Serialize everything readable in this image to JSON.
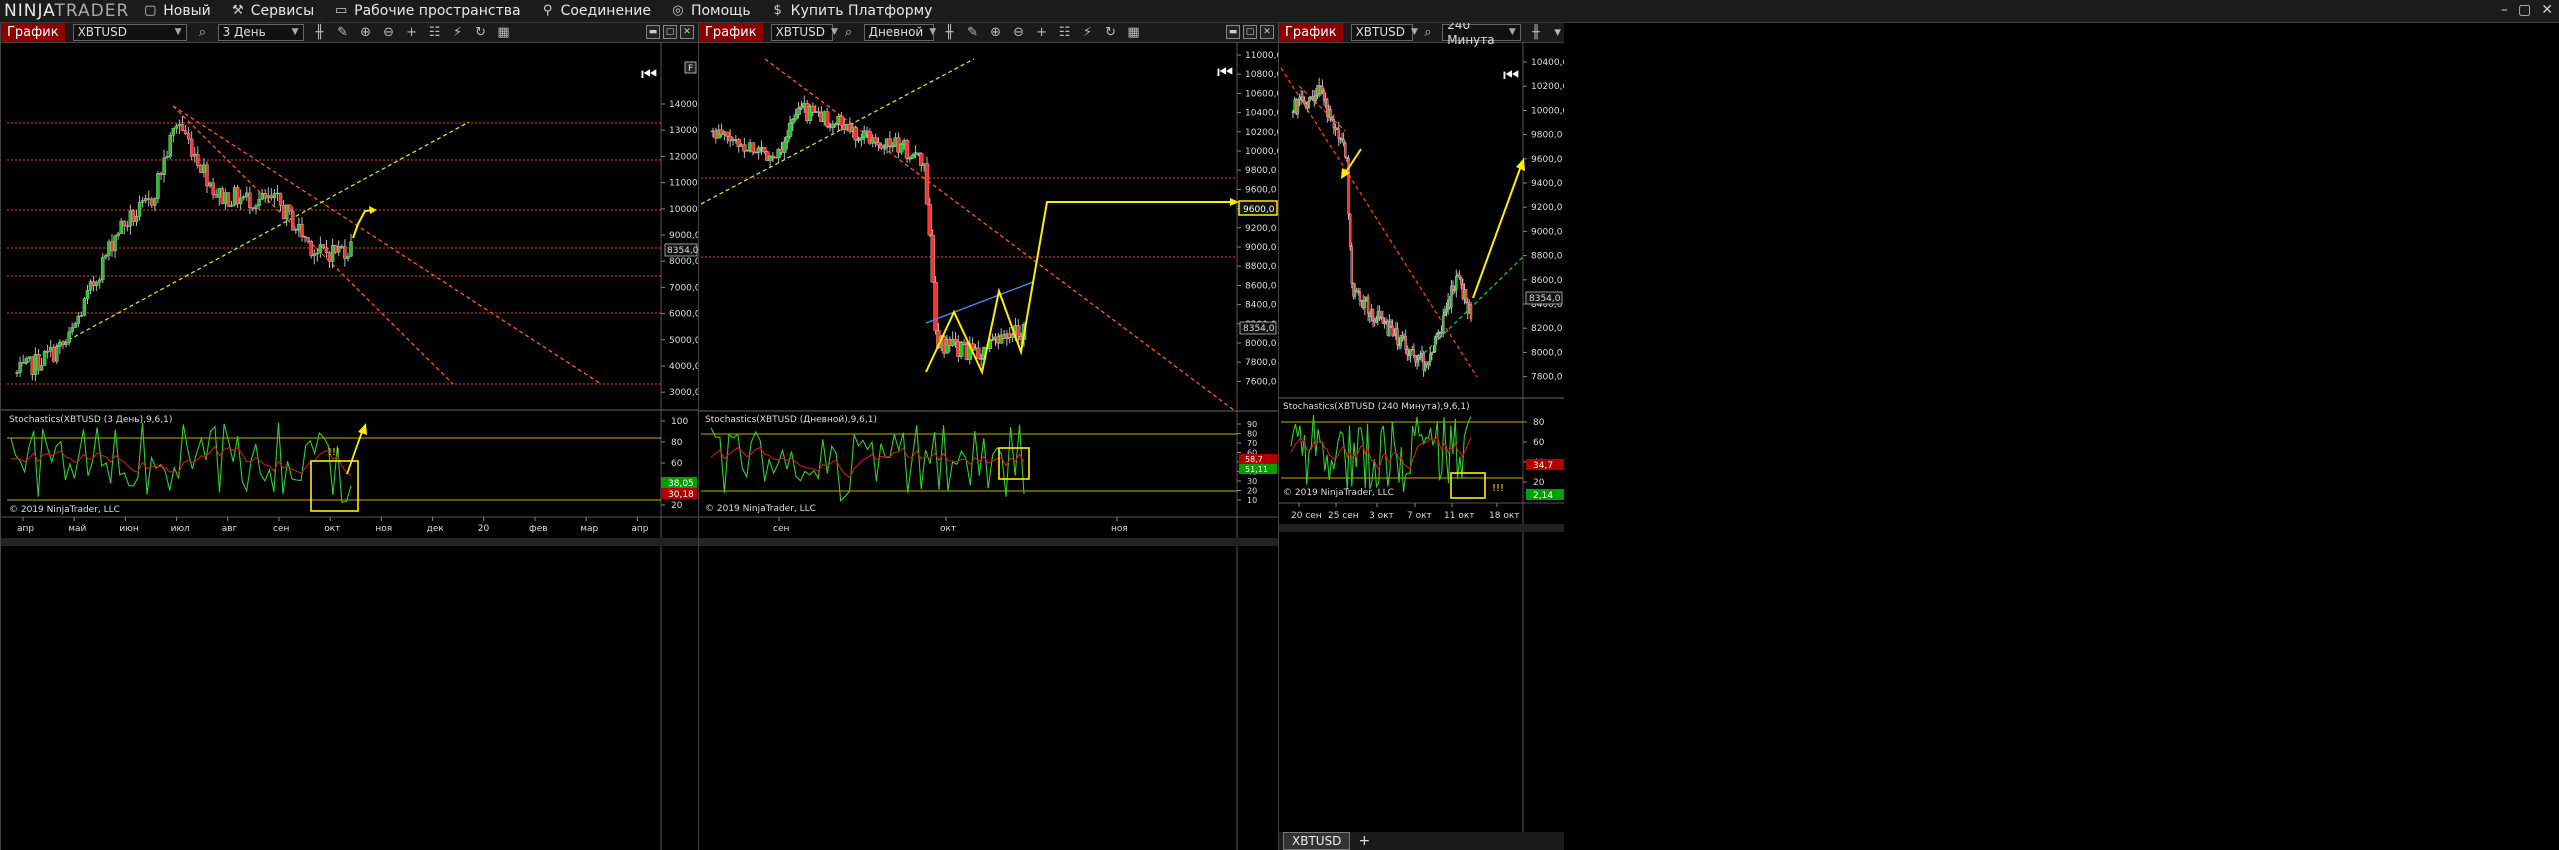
{
  "app": {
    "logo_left": "NINJA",
    "logo_right": "TRADER"
  },
  "menu": [
    {
      "label": "Новый",
      "icon": "document-icon"
    },
    {
      "label": "Сервисы",
      "icon": "tools-icon"
    },
    {
      "label": "Рабочие пространства",
      "icon": "workspace-icon"
    },
    {
      "label": "Соединение",
      "icon": "plug-icon"
    },
    {
      "label": "Помощь",
      "icon": "lifebuoy-icon"
    },
    {
      "label": "Купить Платформу",
      "icon": "dollar-icon"
    }
  ],
  "panels": [
    {
      "title": "График",
      "instrument": "XBTUSD",
      "period": "3 День",
      "price_labels": [
        "14000,0",
        "13000,0",
        "12000,0",
        "11000,0",
        "10000,0",
        "9000,0",
        "8000,0",
        "7000,0",
        "6000,0",
        "5000,0",
        "4000,0",
        "3000,0"
      ],
      "last_price": "8354,0",
      "x_labels": [
        "апр",
        "май",
        "июн",
        "июл",
        "авг",
        "сен",
        "окт",
        "ноя",
        "дек",
        "20",
        "фев",
        "мар",
        "апр"
      ],
      "stoch_title": "Stochastics(XBTUSD (3 День),9,6,1)",
      "stoch_labels": [
        "100",
        "80",
        "60",
        "40",
        "20"
      ],
      "stoch_k": "38,05",
      "stoch_d": "30,18",
      "annotation": "!!!",
      "copyright": "© 2019 NinjaTrader, LLC",
      "f_button": "F"
    },
    {
      "title": "График",
      "instrument": "XBTUSD",
      "period": "Дневной",
      "price_labels": [
        "11000,0",
        "10800,0",
        "10600,0",
        "10400,0",
        "10200,0",
        "10000,0",
        "9800,0",
        "9600,0",
        "9400,0",
        "9200,0",
        "9000,0",
        "8800,0",
        "8600,0",
        "8400,0",
        "8200,0",
        "8000,0",
        "7800,0",
        "7600,0"
      ],
      "last_price": "8354,0",
      "target_price": "9600,0",
      "x_labels": [
        "сен",
        "окт",
        "ноя"
      ],
      "stoch_title": "Stochastics(XBTUSD (Дневной),9,6,1)",
      "stoch_labels": [
        "90",
        "80",
        "70",
        "60",
        "50",
        "40",
        "30",
        "20",
        "10"
      ],
      "stoch_k": "58,7",
      "stoch_d": "51,11",
      "copyright": "© 2019 NinjaTrader, LLC"
    },
    {
      "title": "График",
      "instrument": "XBTUSD",
      "period": "240 Минута",
      "price_labels": [
        "10400,0",
        "10200,0",
        "10000,0",
        "9800,0",
        "9600,0",
        "9400,0",
        "9200,0",
        "9000,0",
        "8800,0",
        "8600,0",
        "8400,0",
        "8200,0",
        "8000,0",
        "7800,0"
      ],
      "last_price": "8354,0",
      "x_labels": [
        "20 сен",
        "25 сен",
        "3 окт",
        "7 окт",
        "11 окт",
        "18 окт"
      ],
      "stoch_title": "Stochastics(XBTUSD (240 Минута),9,6,1)",
      "stoch_labels": [
        "80",
        "60",
        "40",
        "20"
      ],
      "stoch_k": "34,7",
      "stoch_d": "2,14",
      "annotation": "!!!",
      "copyright": "© 2019 NinjaTrader, LLC",
      "tab_label": "XBTUSD",
      "tab_plus": "+"
    }
  ],
  "colors": {
    "up": "#22c522",
    "down": "#ff3030",
    "fib": "#ff3b1a",
    "trend": "#ff5a1a",
    "support": "#c8e62a",
    "yellow": "#ffee00",
    "blue": "#4a7fe0",
    "stoch_k": "#2fd02f",
    "stoch_d": "#cc1c1c"
  }
}
